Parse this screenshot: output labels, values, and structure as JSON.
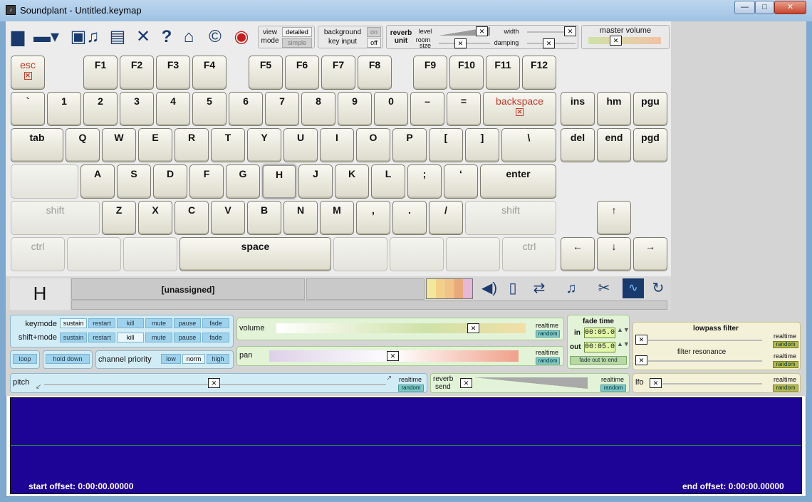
{
  "window": {
    "title": "Soundplant - Untitled.keymap",
    "minimize": "—",
    "maximize": "□",
    "close": "✕"
  },
  "toolbar": {
    "view_mode": {
      "label1": "view",
      "label2": "mode",
      "option_detailed": "detailed",
      "option_simple": "simple"
    },
    "background_input": {
      "label1": "background",
      "label2": "key input",
      "on": "on",
      "off": "off"
    },
    "reverb_unit": {
      "label1": "reverb",
      "label2": "unit",
      "level": "level",
      "room": "room",
      "size": "size",
      "width": "width",
      "damping": "damping"
    },
    "master_volume": {
      "label": "master volume"
    }
  },
  "keyboard": {
    "fn_row": [
      "esc",
      "F1",
      "F2",
      "F3",
      "F4",
      "F5",
      "F6",
      "F7",
      "F8",
      "F9",
      "F10",
      "F11",
      "F12"
    ],
    "number_row": [
      "`",
      "1",
      "2",
      "3",
      "4",
      "5",
      "6",
      "7",
      "8",
      "9",
      "0",
      "–",
      "=",
      "backspace"
    ],
    "nav_row1": [
      "ins",
      "hm",
      "pgu"
    ],
    "q_row": [
      "tab",
      "Q",
      "W",
      "E",
      "R",
      "T",
      "Y",
      "U",
      "I",
      "O",
      "P",
      "[",
      "]",
      "\\"
    ],
    "nav_row2": [
      "del",
      "end",
      "pgd"
    ],
    "a_row": [
      "A",
      "S",
      "D",
      "F",
      "G",
      "H",
      "J",
      "K",
      "L",
      ";",
      "‘",
      "enter"
    ],
    "z_row": [
      "shift",
      "Z",
      "X",
      "C",
      "V",
      "B",
      "N",
      "M",
      ",",
      ".",
      "/",
      "shift"
    ],
    "bottom_row": [
      "ctrl",
      "space",
      "ctrl"
    ],
    "arrows": {
      "up": "↑",
      "left": "←",
      "down": "↓",
      "right": "→"
    }
  },
  "info_bar": {
    "key": "H",
    "status": "[unassigned]"
  },
  "controls": {
    "keymode": {
      "label": "keymode",
      "options": [
        "sustain",
        "restart",
        "kill",
        "mute",
        "pause",
        "fade"
      ],
      "active": "sustain"
    },
    "shift_mode": {
      "label": "shift+mode",
      "options": [
        "sustain",
        "restart",
        "kill",
        "mute",
        "pause",
        "fade"
      ],
      "active": "kill"
    },
    "loop": "loop",
    "hold_down": "hold down",
    "channel_priority": {
      "label": "channel priority",
      "options": [
        "low",
        "norm",
        "high"
      ],
      "active": "norm"
    },
    "volume": {
      "label": "volume",
      "realtime": "realtime",
      "random": "random"
    },
    "pan": {
      "label": "pan",
      "realtime": "realtime",
      "random": "random"
    },
    "fade_time": {
      "label": "fade time",
      "in_label": "in",
      "in_value": "00:05.0",
      "out_label": "out",
      "out_value": "00:05.0",
      "fade_out_to_end": "fade out to end"
    },
    "lowpass_filter": {
      "label": "lowpass filter",
      "realtime": "realtime",
      "random": "random"
    },
    "filter_resonance": {
      "label": "filter resonance",
      "realtime": "realtime",
      "random": "random"
    },
    "pitch": {
      "label": "pitch",
      "realtime": "realtime",
      "random": "random"
    },
    "reverb_send": {
      "label1": "reverb",
      "label2": "send",
      "realtime": "realtime",
      "random": "random"
    },
    "lfo": {
      "label": "lfo",
      "realtime": "realtime",
      "random": "random"
    }
  },
  "waveform": {
    "start_offset": "start offset: 0:00:00.00000",
    "end_offset": "end offset: 0:00:00.00000"
  },
  "colors": {
    "accent": "#1a3a6e",
    "waveform_bg": "#1e0496",
    "waveform_line": "#1f8a3a",
    "key_label_red": "#c43a2c"
  }
}
